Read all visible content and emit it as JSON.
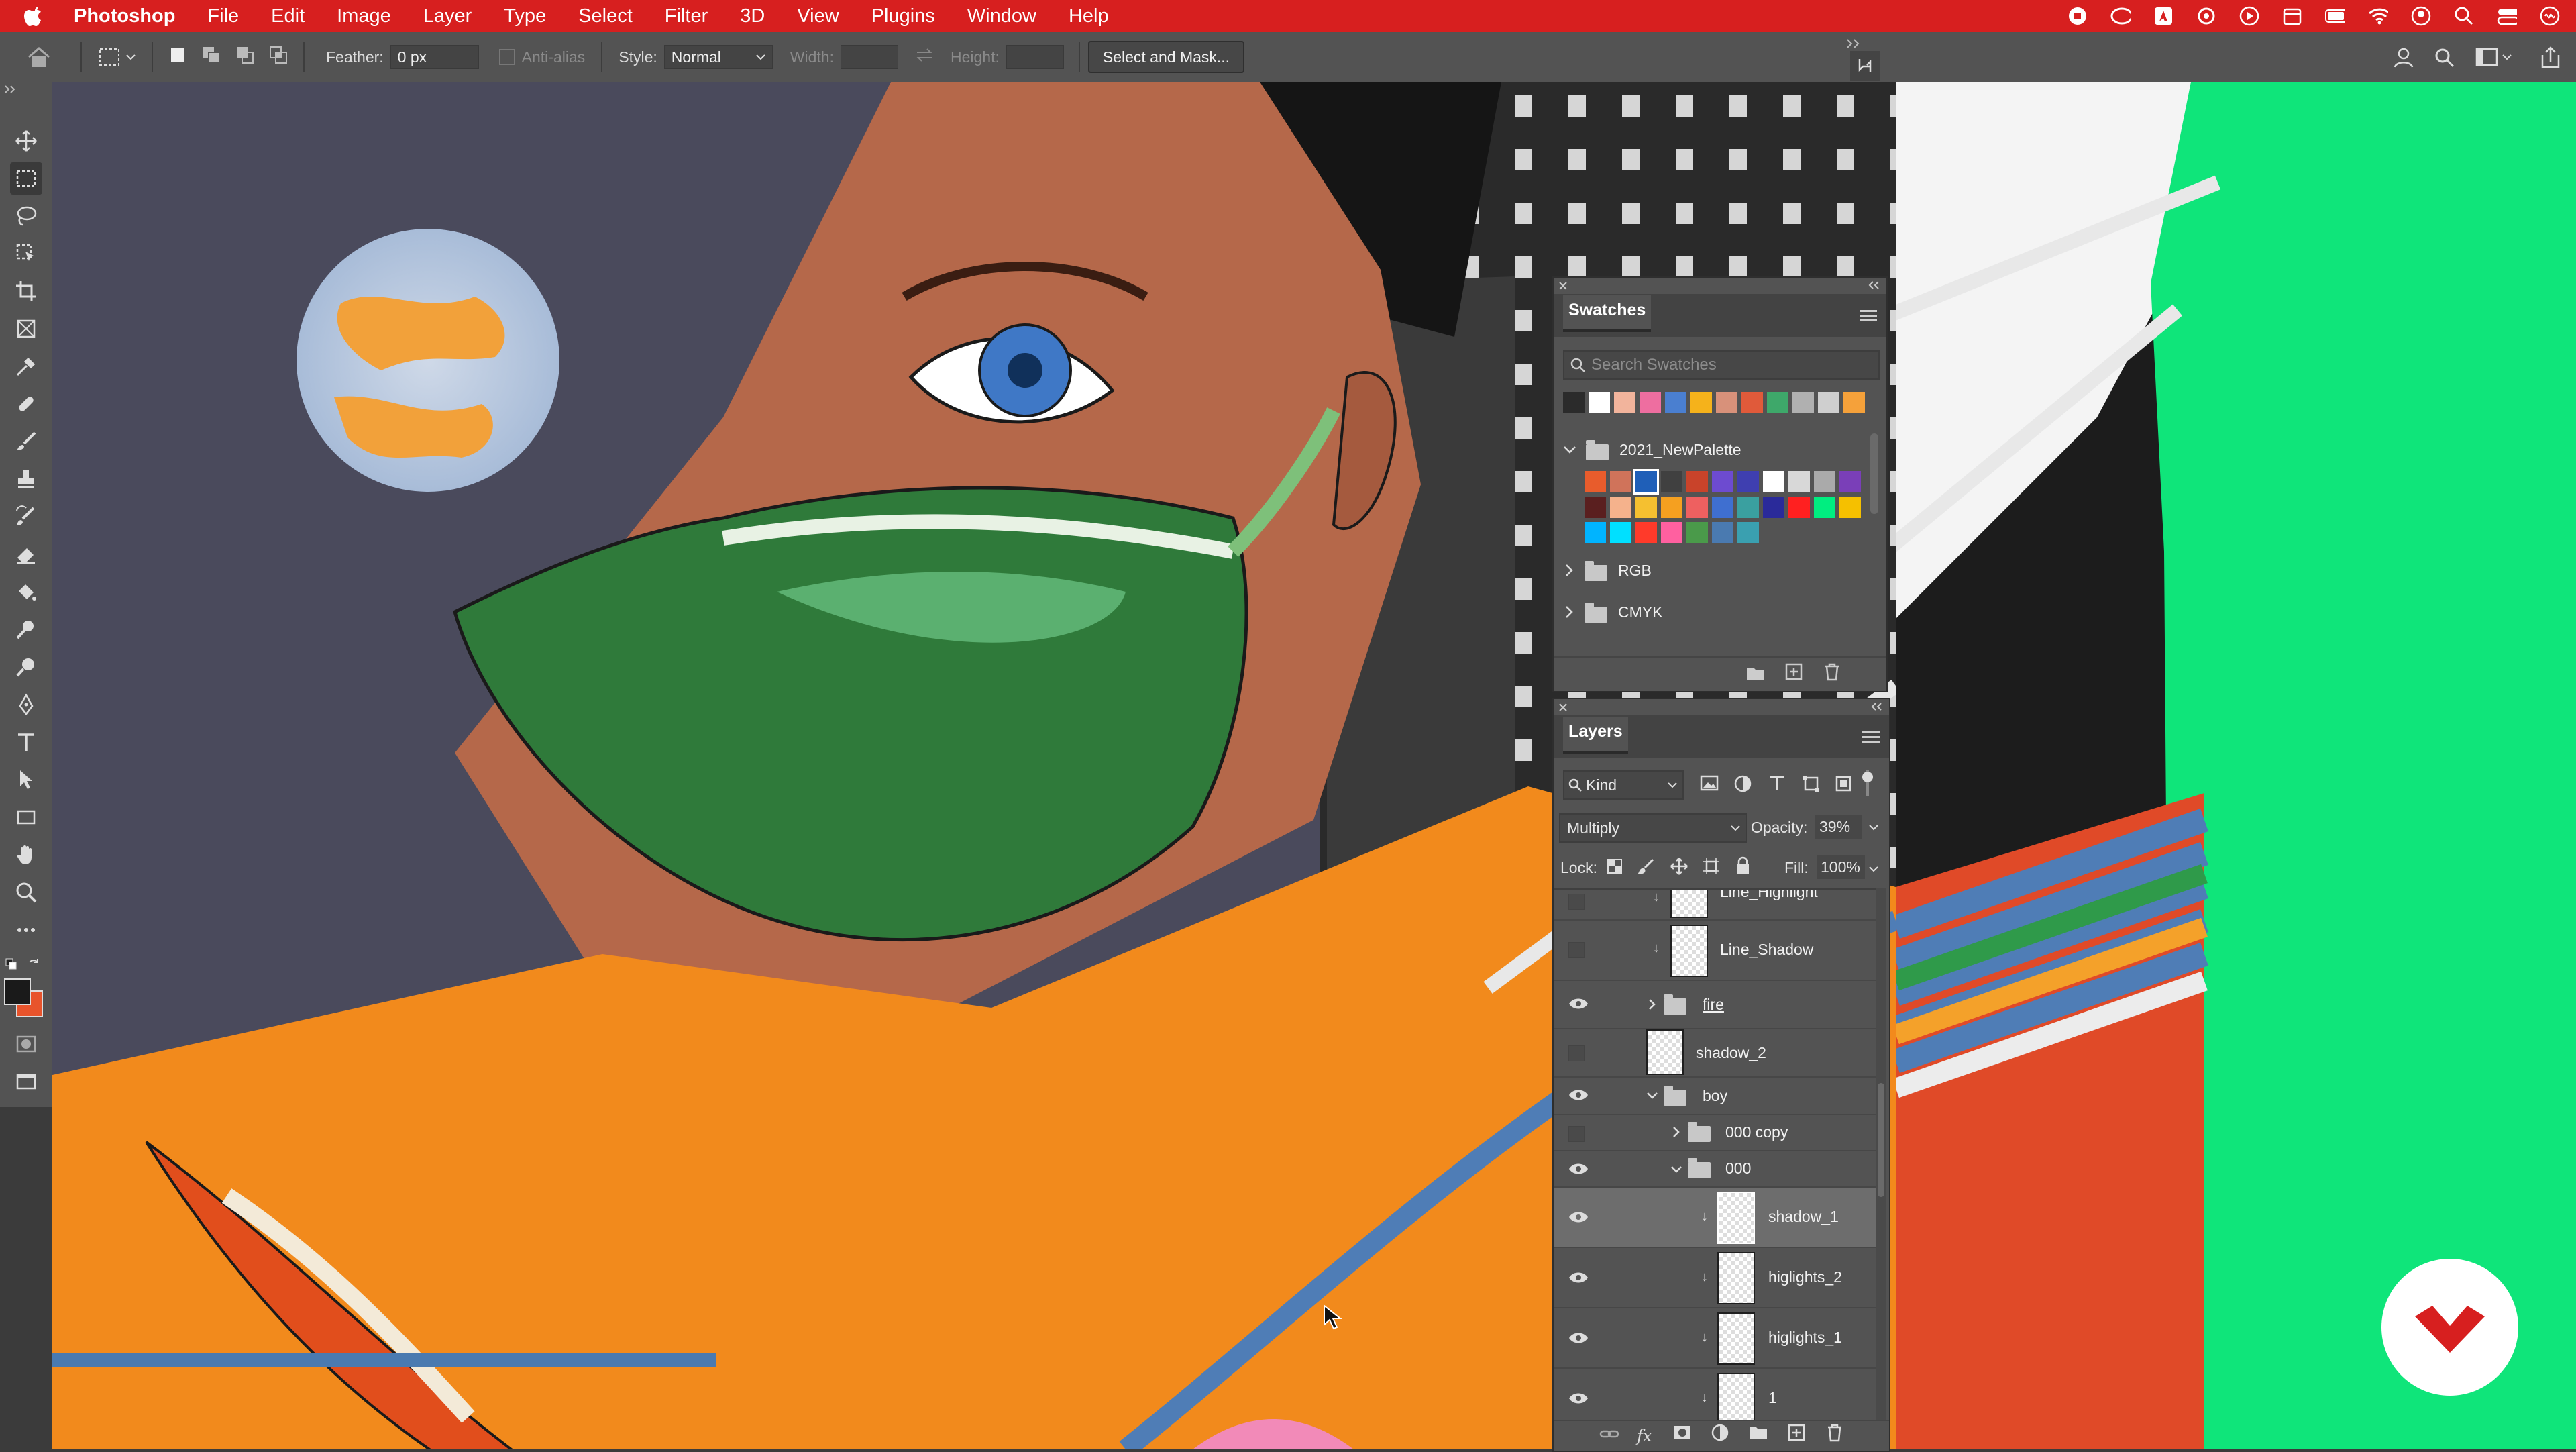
{
  "menubar": {
    "app_name": "Photoshop",
    "items": [
      "File",
      "Edit",
      "Image",
      "Layer",
      "Type",
      "Select",
      "Filter",
      "3D",
      "View",
      "Plugins",
      "Window",
      "Help"
    ]
  },
  "options_bar": {
    "feather_label": "Feather:",
    "feather_value": "0 px",
    "anti_alias_label": "Anti-alias",
    "style_label": "Style:",
    "style_value": "Normal",
    "width_label": "Width:",
    "height_label": "Height:",
    "select_mask_label": "Select and Mask..."
  },
  "colors": {
    "menubar": "#d71f1f",
    "panel": "#535353",
    "foreground": "#1a1a1a",
    "background": "#e8542c"
  },
  "swatches": {
    "tab": "Swatches",
    "search_placeholder": "Search Swatches",
    "recent": [
      "#2b2b2b",
      "#ffffff",
      "#f2b49c",
      "#ee6ea0",
      "#4a7fd0",
      "#f5b21b",
      "#d8917a",
      "#e05a3a",
      "#3ea86a",
      "#b0b0b0",
      "#cfcfcf",
      "#f5a13a"
    ],
    "groups": [
      {
        "name": "2021_NewPalette",
        "expanded": true,
        "colors": [
          "#e85c2c",
          "#d0735a",
          "#1f5fb8",
          "#404040",
          "#c9432a",
          "#6d4bd0",
          "#3f3fb0",
          "#ffffff",
          "#d8d8d8",
          "#aaaaaa",
          "#7a3fb8",
          "#5a1f1f",
          "#f5b28c",
          "#f5c030",
          "#f5a020",
          "#ee6060",
          "#3f6fd0",
          "#3aa0a0",
          "#2a2a9a",
          "#ff2020",
          "#00ee80",
          "#f5c000",
          "#00b4ff",
          "#00e0ff",
          "#ff3a2a",
          "#ff60a0",
          "#4a9a4a",
          "#4a7ab0",
          "#3aa0b0"
        ]
      },
      {
        "name": "RGB",
        "expanded": false
      },
      {
        "name": "CMYK",
        "expanded": false
      }
    ]
  },
  "layers": {
    "tab": "Layers",
    "filter_kind": "Kind",
    "blend_mode": "Multiply",
    "opacity_label": "Opacity:",
    "opacity_value": "39%",
    "lock_label": "Lock:",
    "fill_label": "Fill:",
    "fill_value": "100%",
    "rows": [
      {
        "name": "Line_Highlight",
        "type": "layer",
        "visible": false,
        "clipped": true
      },
      {
        "name": "Line_Shadow",
        "type": "layer",
        "visible": false,
        "clipped": true
      },
      {
        "name": "fire",
        "type": "group",
        "visible": true,
        "expanded": false
      },
      {
        "name": "shadow_2",
        "type": "layer",
        "visible": false
      },
      {
        "name": "boy",
        "type": "group",
        "visible": true,
        "expanded": true
      },
      {
        "name": "000 copy",
        "type": "group",
        "visible": false,
        "expanded": false
      },
      {
        "name": "000",
        "type": "group",
        "visible": true,
        "expanded": true
      },
      {
        "name": "shadow_1",
        "type": "layer",
        "visible": true,
        "clipped": true,
        "selected": true
      },
      {
        "name": "higlights_2",
        "type": "layer",
        "visible": true,
        "clipped": true
      },
      {
        "name": "higlights_1",
        "type": "layer",
        "visible": true,
        "clipped": true
      },
      {
        "name": "1",
        "type": "layer",
        "visible": true,
        "clipped": true
      }
    ]
  }
}
